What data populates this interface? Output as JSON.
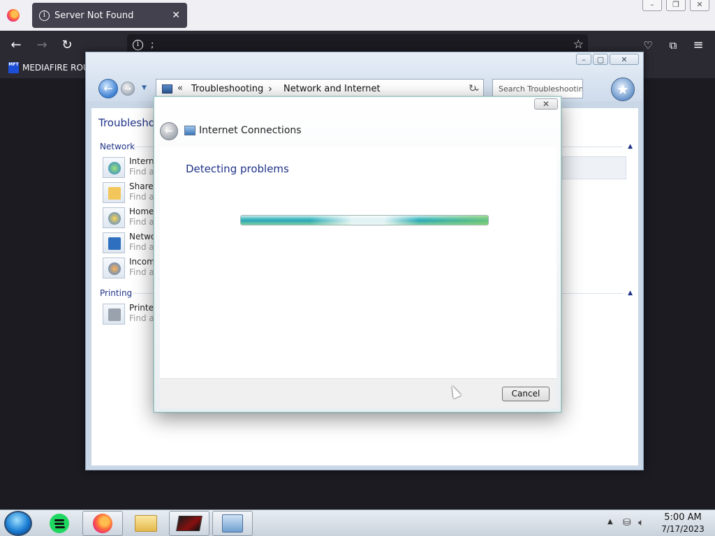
{
  "browser": {
    "tab_title": "Server Not Found",
    "url_text": ";",
    "bookmark_label": "MEDIAFIRE ROUL",
    "bookmark_icon_text": "MFT"
  },
  "control_panel": {
    "breadcrumb_1": "Troubleshooting",
    "breadcrumb_2": "Network and Internet",
    "search_placeholder": "Search Troubleshooting",
    "heading": "Troublesho",
    "group_network": "Network",
    "group_printing": "Printing",
    "items": [
      {
        "name": "Interne",
        "desc": "Find an",
        "icon": "internet-connections-icon"
      },
      {
        "name": "Shared",
        "desc": "Find an",
        "icon": "shared-folders-icon"
      },
      {
        "name": "HomeG",
        "desc": "Find an",
        "icon": "homegroup-icon"
      },
      {
        "name": "Netwo",
        "desc": "Find an",
        "icon": "network-adapter-icon"
      },
      {
        "name": "Incomi",
        "desc": "Find an",
        "icon": "incoming-connections-icon"
      },
      {
        "name": "Printer",
        "desc": "Find an",
        "icon": "printer-icon"
      }
    ]
  },
  "dialog": {
    "title": "Internet Connections",
    "heading": "Detecting problems",
    "progress": 1.0,
    "cancel_label": "Cancel"
  },
  "taskbar": {
    "time": "5:00 AM",
    "date": "7/17/2023",
    "apps": [
      "spotify",
      "firefox",
      "file-explorer",
      "game",
      "troubleshooter"
    ]
  },
  "colors": {
    "accent_blue": "#1e3287",
    "progress_teal": "#2aa7b8",
    "progress_green": "#7cd0a0"
  }
}
